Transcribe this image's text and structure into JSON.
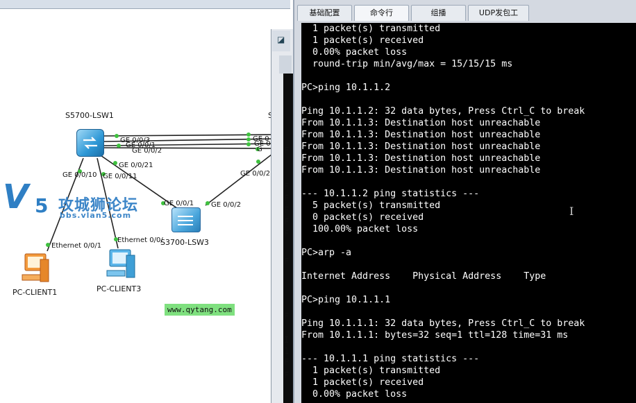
{
  "topology": {
    "devices": {
      "lsw1": "S5700-LSW1",
      "lsw3": "S3700-LSW3",
      "pc1": "PC-CLIENT1",
      "pc3": "PC-CLIENT3"
    },
    "ports": {
      "ge003": "GE 0/0/3",
      "ge001_top": "GE 0/0/1",
      "ge002_top": "GE 0/0/2",
      "ge0021": "GE 0/0/21",
      "ge0010": "GE 0/0/10",
      "ge0011": "GE 0/0/11",
      "ge001_lsw3": "GE 0/0/1",
      "ge002_lsw3": "GE 0/0/2",
      "ge002_right": "GE 0/0/2",
      "ge_right_a": "GE 0",
      "ge_right_b": "GE 0",
      "ge_right_c": "G",
      "eth001": "Ethernet 0/0/1",
      "eth004": "Ethernet 0/0/"
    },
    "partial_label": "S"
  },
  "watermark": {
    "cn": "攻城狮论坛",
    "url": "bbs.vlan5.com",
    "qytang": "www.qytang.com"
  },
  "behind_letters": [
    "F",
    "F",
    "F",
    "F",
    "F",
    "F",
    "F",
    "F",
    "F",
    "I",
    "1",
    "F"
  ],
  "tabs": [
    "基础配置",
    "命令行",
    "组播",
    "UDP发包工具"
  ],
  "terminal": {
    "lines": [
      "  1 packet(s) transmitted",
      "  1 packet(s) received",
      "  0.00% packet loss",
      "  round-trip min/avg/max = 15/15/15 ms",
      "",
      "PC>ping 10.1.1.2",
      "",
      "Ping 10.1.1.2: 32 data bytes, Press Ctrl_C to break",
      "From 10.1.1.3: Destination host unreachable",
      "From 10.1.1.3: Destination host unreachable",
      "From 10.1.1.3: Destination host unreachable",
      "From 10.1.1.3: Destination host unreachable",
      "From 10.1.1.3: Destination host unreachable",
      "",
      "--- 10.1.1.2 ping statistics ---",
      "  5 packet(s) transmitted",
      "  0 packet(s) received",
      "  100.00% packet loss",
      "",
      "PC>arp -a",
      "",
      "Internet Address    Physical Address    Type",
      "",
      "PC>ping 10.1.1.1",
      "",
      "Ping 10.1.1.1: 32 data bytes, Press Ctrl_C to break",
      "From 10.1.1.1: bytes=32 seq=1 ttl=128 time=31 ms",
      "",
      "--- 10.1.1.1 ping statistics ---",
      "  1 packet(s) transmitted",
      "  1 packet(s) received",
      "  0.00% packet loss"
    ]
  }
}
